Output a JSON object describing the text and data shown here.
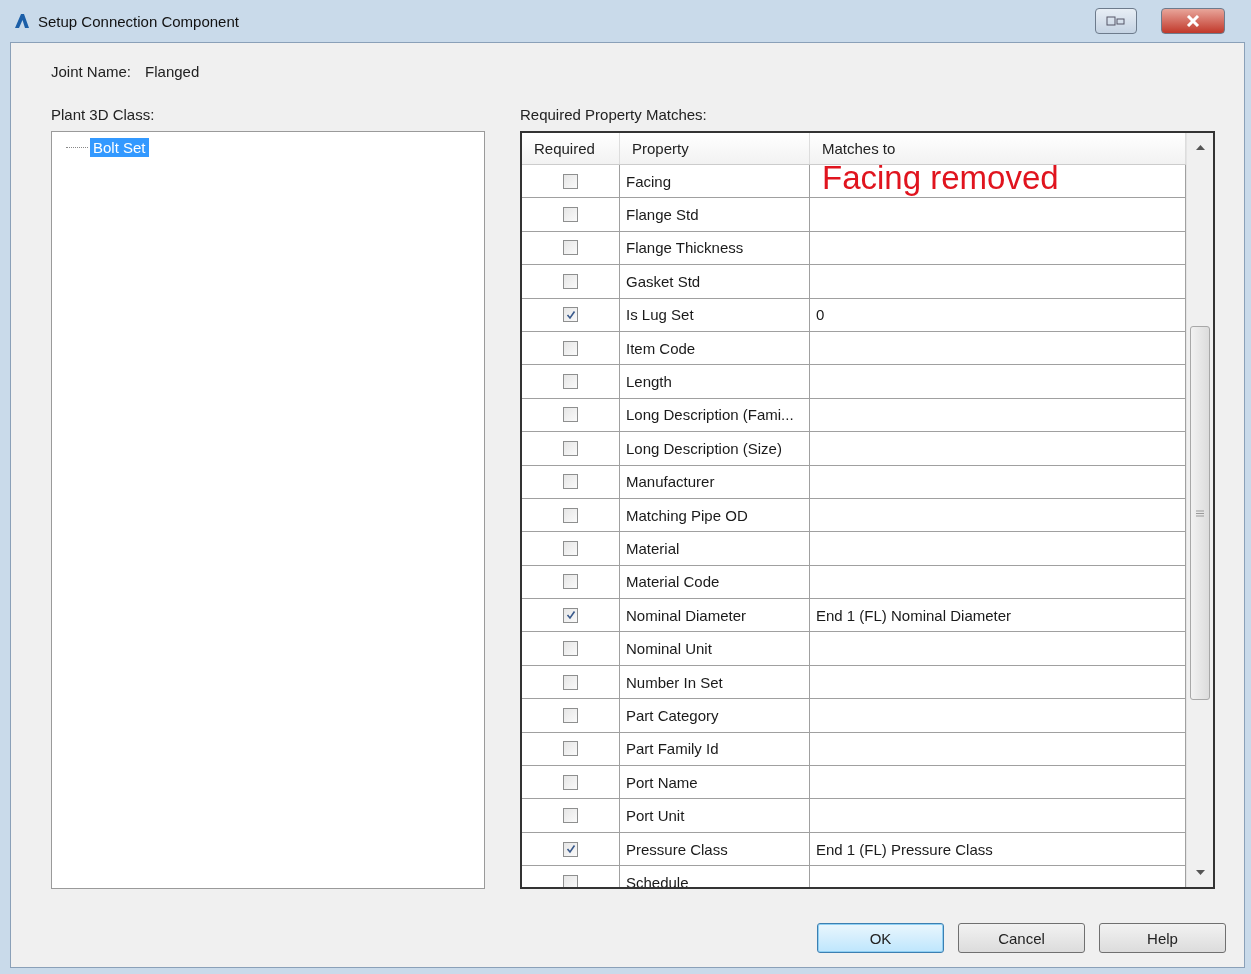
{
  "window": {
    "title": "Setup Connection Component"
  },
  "joint_name": {
    "label": "Joint Name:",
    "value": "Flanged"
  },
  "class_panel": {
    "label": "Plant 3D Class:",
    "items": [
      {
        "label": "Bolt Set",
        "selected": true
      }
    ]
  },
  "matches": {
    "label": "Required Property Matches:",
    "columns": [
      "Required",
      "Property",
      "Matches to"
    ],
    "rows": [
      {
        "required": false,
        "property": "Facing",
        "matches": "Facing removed",
        "highlight": true
      },
      {
        "required": false,
        "property": "Flange Std",
        "matches": "",
        "highlight": false
      },
      {
        "required": false,
        "property": "Flange Thickness",
        "matches": "",
        "highlight": false
      },
      {
        "required": false,
        "property": "Gasket Std",
        "matches": "",
        "highlight": false
      },
      {
        "required": true,
        "property": "Is Lug Set",
        "matches": "0",
        "highlight": false
      },
      {
        "required": false,
        "property": "Item Code",
        "matches": "",
        "highlight": false
      },
      {
        "required": false,
        "property": "Length",
        "matches": "",
        "highlight": false
      },
      {
        "required": false,
        "property": "Long Description (Fami...",
        "matches": "",
        "highlight": false
      },
      {
        "required": false,
        "property": "Long Description (Size)",
        "matches": "",
        "highlight": false
      },
      {
        "required": false,
        "property": "Manufacturer",
        "matches": "",
        "highlight": false
      },
      {
        "required": false,
        "property": "Matching Pipe OD",
        "matches": "",
        "highlight": false
      },
      {
        "required": false,
        "property": "Material",
        "matches": "",
        "highlight": false
      },
      {
        "required": false,
        "property": "Material Code",
        "matches": "",
        "highlight": false
      },
      {
        "required": true,
        "property": "Nominal Diameter",
        "matches": "End 1 (FL) Nominal Diameter",
        "highlight": false
      },
      {
        "required": false,
        "property": "Nominal Unit",
        "matches": "",
        "highlight": false
      },
      {
        "required": false,
        "property": "Number In Set",
        "matches": "",
        "highlight": false
      },
      {
        "required": false,
        "property": "Part Category",
        "matches": "",
        "highlight": false
      },
      {
        "required": false,
        "property": "Part Family Id",
        "matches": "",
        "highlight": false
      },
      {
        "required": false,
        "property": "Port Name",
        "matches": "",
        "highlight": false
      },
      {
        "required": false,
        "property": "Port Unit",
        "matches": "",
        "highlight": false
      },
      {
        "required": true,
        "property": "Pressure Class",
        "matches": "End 1 (FL) Pressure Class",
        "highlight": false
      },
      {
        "required": false,
        "property": "Schedule",
        "matches": "",
        "highlight": false
      }
    ]
  },
  "buttons": [
    {
      "label": "OK",
      "default": true
    },
    {
      "label": "Cancel",
      "default": false
    },
    {
      "label": "Help",
      "default": false
    }
  ]
}
